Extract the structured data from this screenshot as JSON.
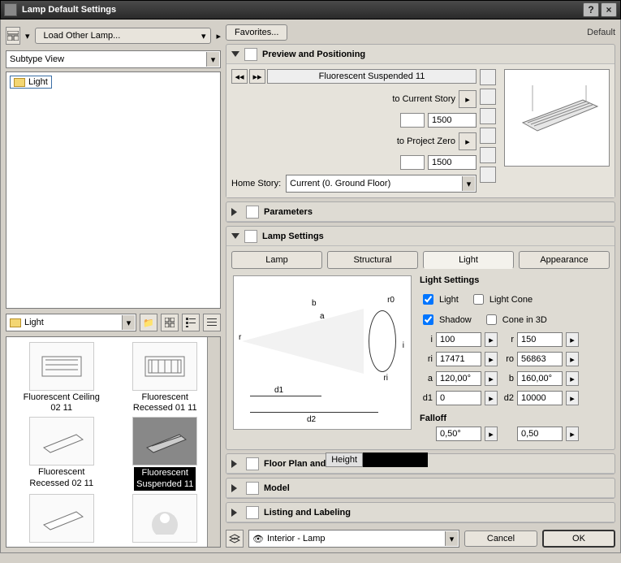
{
  "window": {
    "title": "Lamp Default Settings"
  },
  "left": {
    "load_button": "Load Other Lamp...",
    "view_dropdown": "Subtype View",
    "tree_item": "Light",
    "browser_label": "Light",
    "thumbs": [
      {
        "label": "Fluorescent Ceiling\n02 11"
      },
      {
        "label": "Fluorescent\nRecessed 01 11"
      },
      {
        "label": "Fluorescent\nRecessed 02 11"
      },
      {
        "label": "Fluorescent\nSuspended 11",
        "selected": true
      },
      {
        "label": " "
      },
      {
        "label": " "
      }
    ]
  },
  "right": {
    "favorites": "Favorites...",
    "scope": "Default",
    "sections": {
      "preview": {
        "title": "Preview and Positioning",
        "object_name": "Fluorescent Suspended 11",
        "to_story_label": "to Current Story",
        "to_story_value": "1500",
        "to_zero_label": "to Project Zero",
        "to_zero_value": "1500",
        "home_story_label": "Home Story:",
        "home_story_value": "Current (0. Ground Floor)"
      },
      "parameters": {
        "title": "Parameters"
      },
      "lamp": {
        "title": "Lamp Settings",
        "tabs": {
          "lamp": "Lamp",
          "structural": "Structural",
          "light": "Light",
          "appearance": "Appearance"
        },
        "diagram_labels": {
          "r": "r",
          "a": "a",
          "b": "b",
          "r0": "r0",
          "ri": "ri",
          "i": "i",
          "d1": "d1",
          "d2": "d2"
        },
        "settings_title": "Light Settings",
        "chk": {
          "light": "Light",
          "shadow": "Shadow",
          "lightcone": "Light Cone",
          "cone3d": "Cone in 3D"
        },
        "params": {
          "i": "100",
          "r": "150",
          "ri": "17471",
          "ro": "56863",
          "a": "120,00°",
          "b": "160,00°",
          "d1": "0",
          "d2": "10000"
        },
        "falloff_label": "Falloff",
        "falloff_a": "0,50°",
        "falloff_b": "0,50"
      },
      "floorplan": {
        "title": "Floor Plan and Secti",
        "badge": "Height"
      },
      "model": {
        "title": "Model"
      },
      "listing": {
        "title": "Listing and Labeling"
      }
    },
    "layer": "Interior - Lamp",
    "cancel": "Cancel",
    "ok": "OK"
  }
}
